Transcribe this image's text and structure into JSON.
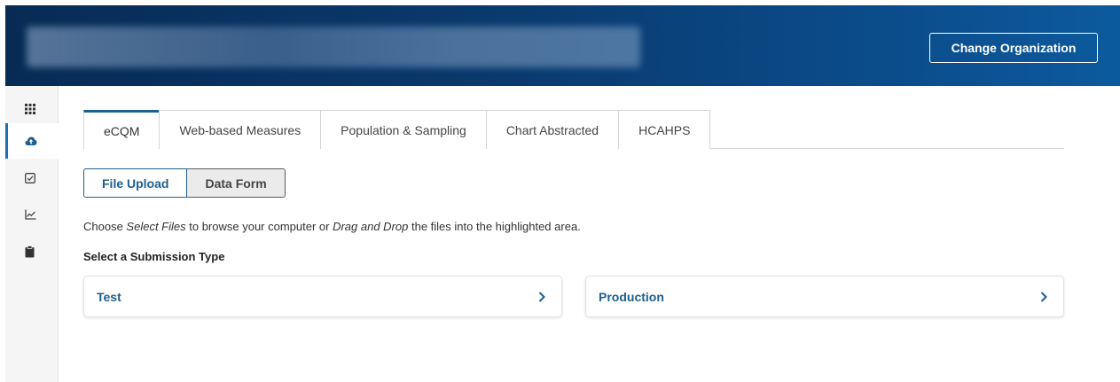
{
  "header": {
    "change_org_label": "Change Organization",
    "background_colors": [
      "#072b55",
      "#0c5a9e"
    ]
  },
  "sidebar": {
    "items": [
      {
        "icon": "apps-grid-icon",
        "active": false
      },
      {
        "icon": "cloud-upload-icon",
        "active": true
      },
      {
        "icon": "checkbox-icon",
        "active": false
      },
      {
        "icon": "line-chart-icon",
        "active": false
      },
      {
        "icon": "clipboard-icon",
        "active": false
      }
    ]
  },
  "tabs": [
    {
      "label": "eCQM",
      "active": true
    },
    {
      "label": "Web-based Measures",
      "active": false
    },
    {
      "label": "Population & Sampling",
      "active": false
    },
    {
      "label": "Chart Abstracted",
      "active": false
    },
    {
      "label": "HCAHPS",
      "active": false
    }
  ],
  "toggle": {
    "file_upload": "File Upload",
    "data_form": "Data Form",
    "selected": "File Upload"
  },
  "instructions": {
    "part1": "Choose ",
    "em1": "Select Files",
    "part2": " to browse your computer or ",
    "em2": "Drag and Drop",
    "part3": " the files into the highlighted area."
  },
  "submission": {
    "title": "Select a Submission Type",
    "options": [
      {
        "label": "Test"
      },
      {
        "label": "Production"
      }
    ]
  },
  "colors": {
    "accent": "#1d5f8e",
    "sidebar_active": "#1d6fb5"
  }
}
